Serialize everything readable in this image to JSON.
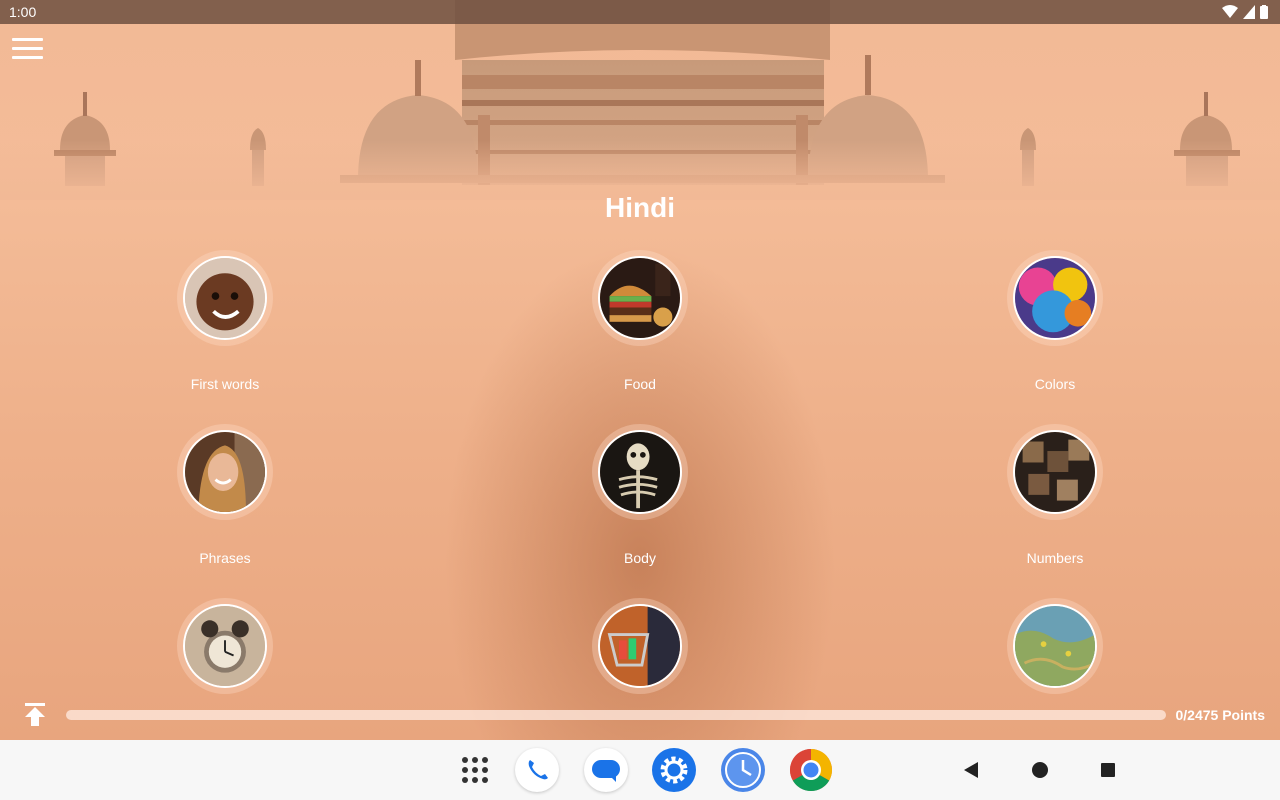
{
  "status_bar": {
    "time": "1:00"
  },
  "header": {
    "title": "Hindi"
  },
  "categories": [
    {
      "label": "First words"
    },
    {
      "label": "Food"
    },
    {
      "label": "Colors"
    },
    {
      "label": "Phrases"
    },
    {
      "label": "Body"
    },
    {
      "label": "Numbers"
    },
    {
      "label": ""
    },
    {
      "label": ""
    },
    {
      "label": ""
    }
  ],
  "progress": {
    "points_text": "0/2475 Points",
    "fraction": 0
  },
  "dock": {
    "apps": [
      "app-drawer",
      "phone",
      "messages",
      "settings",
      "clock",
      "chrome"
    ],
    "nav": [
      "back",
      "home",
      "recents"
    ]
  },
  "colors": {
    "accent": "#f29c5e",
    "background": "#eeb48a"
  }
}
